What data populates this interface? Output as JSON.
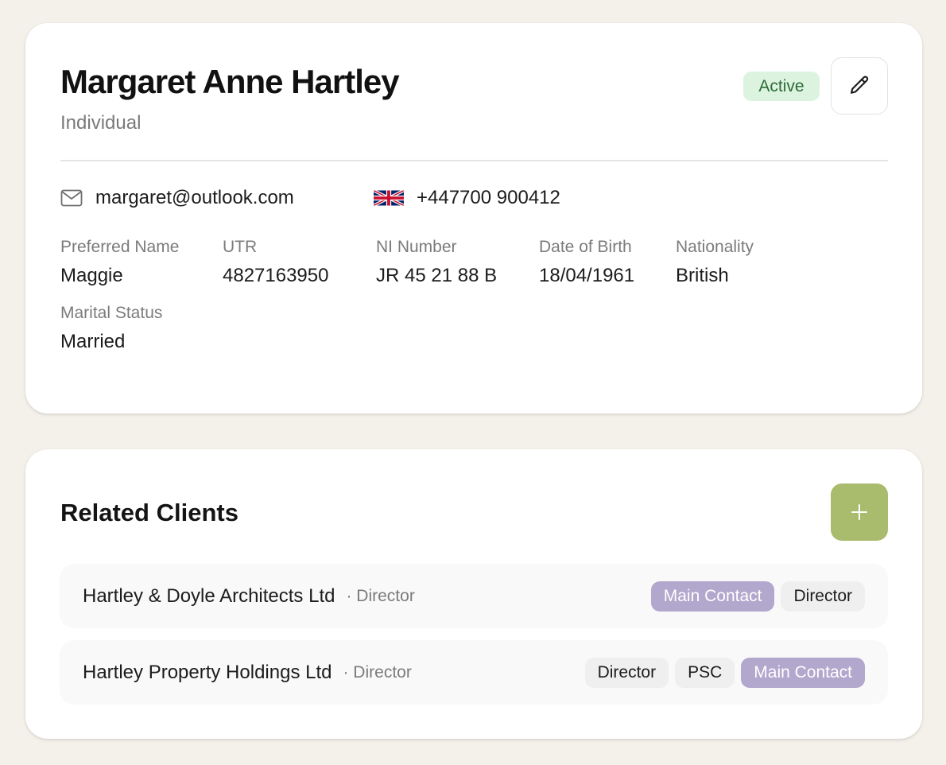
{
  "client": {
    "name": "Margaret Anne Hartley",
    "type": "Individual",
    "status": "Active",
    "email": "margaret@outlook.com",
    "phone": "+447700 900412",
    "phone_country_icon": "uk-flag-icon"
  },
  "fields": [
    {
      "label": "Preferred Name",
      "value": "Maggie"
    },
    {
      "label": "UTR",
      "value": "4827163950"
    },
    {
      "label": "NI Number",
      "value": "JR 45 21 88 B"
    },
    {
      "label": "Date of Birth",
      "value": "18/04/1961"
    },
    {
      "label": "Nationality",
      "value": "British"
    },
    {
      "label": "Marital Status",
      "value": "Married"
    }
  ],
  "related": {
    "title": "Related Clients",
    "items": [
      {
        "name": "Hartley & Doyle Architects Ltd",
        "role": "· Director",
        "tags": [
          "Main Contact",
          "Director"
        ]
      },
      {
        "name": "Hartley Property Holdings Ltd",
        "role": "· Director",
        "tags": [
          "Director",
          "PSC",
          "Main Contact"
        ]
      }
    ]
  },
  "colors": {
    "background": "#f4f0ea",
    "active_badge_bg": "#dcf3df",
    "active_badge_text": "#2e6a38",
    "add_button": "#a9bb6d",
    "main_contact_tag": "#b2a7cc",
    "plain_tag": "#efefef"
  },
  "icons": {
    "edit": "pencil-icon",
    "email": "mail-icon",
    "add": "plus-icon"
  }
}
